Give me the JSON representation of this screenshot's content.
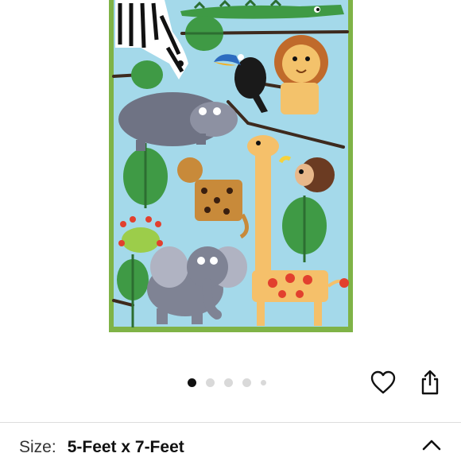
{
  "product": {
    "image_icon": "jungle-animals-rug-image",
    "carousel": {
      "total": 5,
      "active_index": 0
    }
  },
  "actions": {
    "favorite_icon": "heart-icon",
    "share_icon": "share-icon"
  },
  "size_selector": {
    "label": "Size:",
    "value": "5-Feet x 7-Feet",
    "toggle_icon": "chevron-up-icon"
  },
  "colors": {
    "rug_background": "#9fd6e8",
    "rug_border": "#7fb347",
    "active_dot": "#111111",
    "inactive_dot": "#d9d9d9"
  }
}
